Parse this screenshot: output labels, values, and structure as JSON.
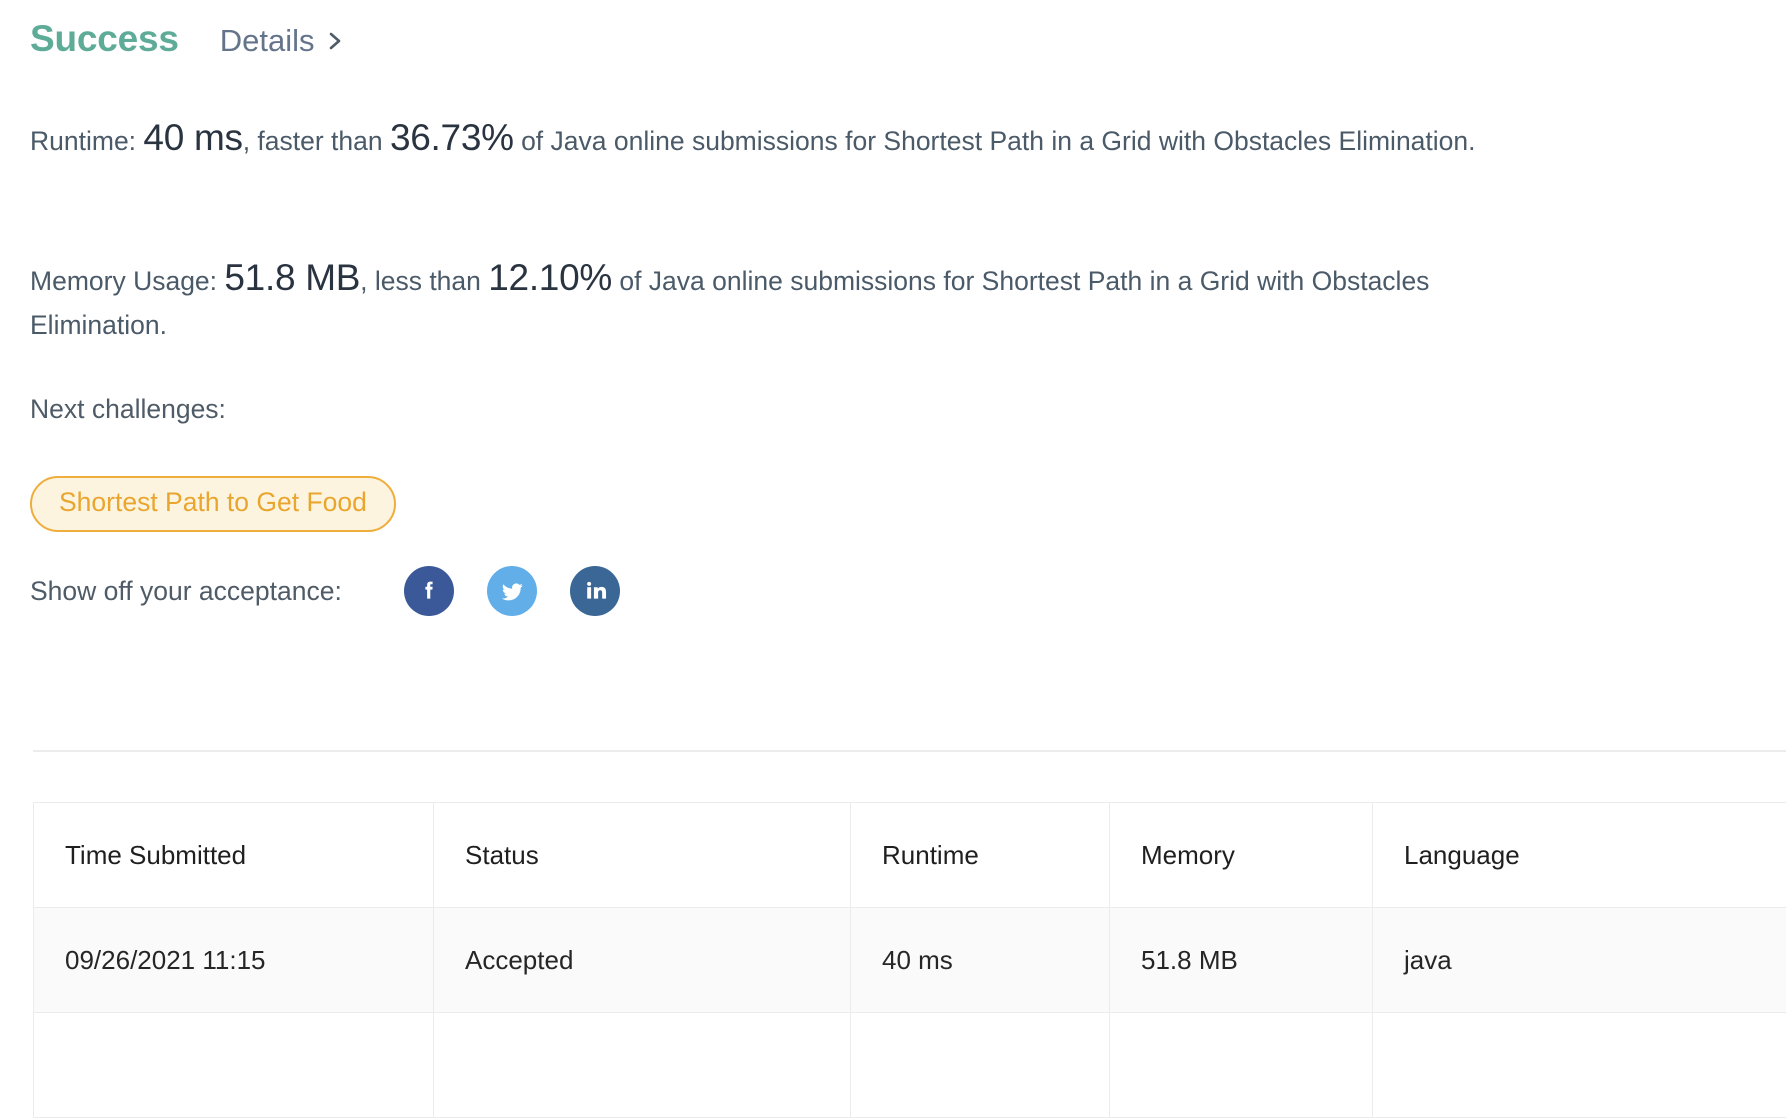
{
  "header": {
    "status": "Success",
    "details_label": "Details",
    "details_chevron_icon": "chevron-right-icon",
    "status_color": "#5eab98"
  },
  "stats": {
    "runtime": {
      "label": "Runtime:",
      "value": "40 ms",
      "comparator": ", faster than ",
      "percentile": "36.73%",
      "suffix": " of Java online submissions for Shortest Path in a Grid with Obstacles Elimination."
    },
    "memory": {
      "label": "Memory Usage:",
      "value": "51.8 MB",
      "comparator": ", less than ",
      "percentile": "12.10%",
      "suffix": " of Java online submissions for Shortest Path in a Grid with Obstacles Elimination."
    }
  },
  "next_challenges": {
    "label": "Next challenges:",
    "items": [
      {
        "label": "Shortest Path to Get Food",
        "border_color": "#eead3c",
        "bg_color": "#fdf4e0",
        "text_color": "#e9a62f"
      }
    ]
  },
  "share": {
    "label": "Show off your acceptance:",
    "buttons": [
      {
        "name": "facebook-icon",
        "glyph": "f",
        "color": "#3b5998"
      },
      {
        "name": "twitter-icon",
        "glyph": "t",
        "color": "#62aee9"
      },
      {
        "name": "linkedin-icon",
        "glyph": "in",
        "color": "#3a6796"
      }
    ]
  },
  "submissions": {
    "columns": [
      "Time Submitted",
      "Status",
      "Runtime",
      "Memory",
      "Language"
    ],
    "rows": [
      {
        "time": "09/26/2021 11:15",
        "status": "Accepted",
        "status_color": "#42998a",
        "runtime": "40 ms",
        "memory": "51.8 MB",
        "language": "java"
      },
      {
        "time": "",
        "status": "",
        "status_color": "#42998a",
        "runtime": "",
        "memory": "",
        "language": ""
      }
    ]
  }
}
